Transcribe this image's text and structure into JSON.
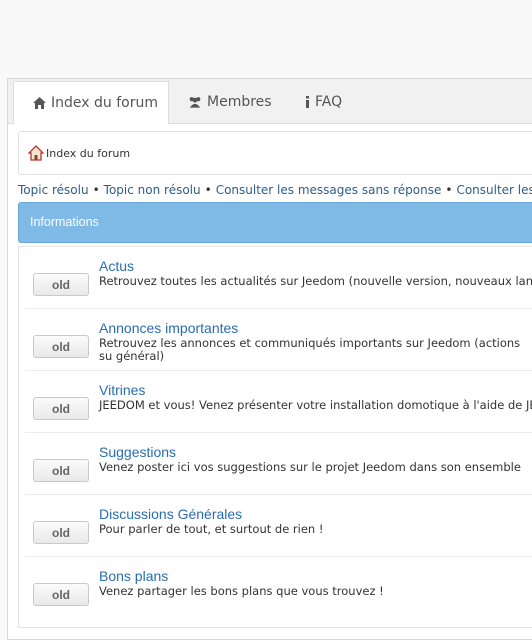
{
  "nav": {
    "tabs": [
      {
        "label": "Index du forum",
        "icon": "home-icon"
      },
      {
        "label": "Membres",
        "icon": "users-icon"
      },
      {
        "label": "FAQ",
        "icon": "info-icon"
      }
    ]
  },
  "breadcrumb": {
    "label": "Index du forum",
    "icon": "home-icon"
  },
  "quick_links": [
    "Topic résolu",
    "Topic non résolu",
    "Consulter les messages sans réponse",
    "Consulter les me"
  ],
  "category": {
    "title": "Informations"
  },
  "forums": [
    {
      "status": "old",
      "title": "Actus",
      "description": "Retrouvez toutes les actualités sur Jeedom (nouvelle version, nouveaux lan"
    },
    {
      "status": "old",
      "title": "Annonces importantes",
      "description": "Retrouvez les annonces et communiqués importants sur Jeedom (actions su général)"
    },
    {
      "status": "old",
      "title": "Vitrines",
      "description": "JEEDOM et vous! Venez présenter votre installation domotique à l'aide de JE"
    },
    {
      "status": "old",
      "title": "Suggestions",
      "description": "Venez poster ici vos suggestions sur le projet Jeedom dans son ensemble"
    },
    {
      "status": "old",
      "title": "Discussions Générales",
      "description": "Pour parler de tout, et surtout de rien !"
    },
    {
      "status": "old",
      "title": "Bons plans",
      "description": "Venez partager les bons plans que vous trouvez !"
    }
  ],
  "colors": {
    "category_header": "#7fb9e6",
    "link": "#2a6db0"
  }
}
